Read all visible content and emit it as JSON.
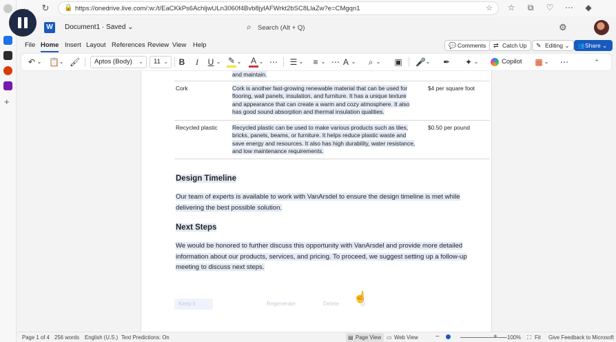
{
  "browser": {
    "url": "https://onedrive.live.com/:w:/t/EaCKkPs6AchljwULn3060f4Bvb8jylAFWrkt2bSC8LlaZw?e=CMgqn1"
  },
  "word": {
    "doc_name": "Document1 · Saved ⌄",
    "search_placeholder": "Search (Alt + Q)",
    "logo_letter": "W"
  },
  "menu": {
    "tabs": [
      "File",
      "Home",
      "Insert",
      "Layout",
      "References",
      "Review",
      "View",
      "Help"
    ],
    "comments": "Comments",
    "catch_up": "Catch Up",
    "editing": "Editing ⌄",
    "share": "Share ⌄"
  },
  "toolbar": {
    "font_name": "Aptos (Body)",
    "font_size": "11",
    "copilot": "Copilot"
  },
  "document": {
    "materials": [
      {
        "material": "",
        "description": "and maintain.",
        "price": ""
      },
      {
        "material": "Cork",
        "description_lines": [
          "Cork is another fast-growing renewable material that can be used for",
          "flooring, wall panels, insulation, and furniture. It has a unique texture",
          "and appearance that can create a warm and cozy atmosphere. It also",
          "has good sound absorption and thermal insulation qualities."
        ],
        "price": "$4 per square foot"
      },
      {
        "material": "Recycled plastic",
        "description_lines": [
          "Recycled plastic can be used to make various products such as tiles,",
          "bricks, panels, beams, or furniture. It helps reduce plastic waste and",
          "save energy and resources. It also has high durability, water resistance,",
          "and low maintenance requirements."
        ],
        "price": "$0.50 per pound"
      }
    ],
    "design_timeline": {
      "heading": "Design Timeline",
      "lines": [
        "Our team of experts is available to work with VanArsdel to ensure the design timeline is met while",
        "delivering the best possible solution."
      ]
    },
    "next_steps": {
      "heading": "Next Steps",
      "lines": [
        "We would be honored to further discuss this opportunity with VanArsdel and provide more detailed",
        "information about our products, services, and pricing. To proceed, we suggest setting up a follow-up",
        "meeting to discuss next steps."
      ]
    },
    "ghost_buttons": [
      "Keep it",
      "Regenerate",
      "Delete"
    ]
  },
  "status_bar": {
    "page": "Page 1 of 4",
    "words": "256 words",
    "language": "English (U.S.)",
    "predictions": "Text Predictions: On",
    "page_view": "Page View",
    "web_view": "Web View",
    "zoom_minus": "−",
    "zoom_plus": "+",
    "zoom_level": "100%",
    "fit": "Fit",
    "feedback": "Give Feedback to Microsoft"
  },
  "colors": {
    "accent": "#185abd",
    "highlight": "#e3eaf5"
  }
}
